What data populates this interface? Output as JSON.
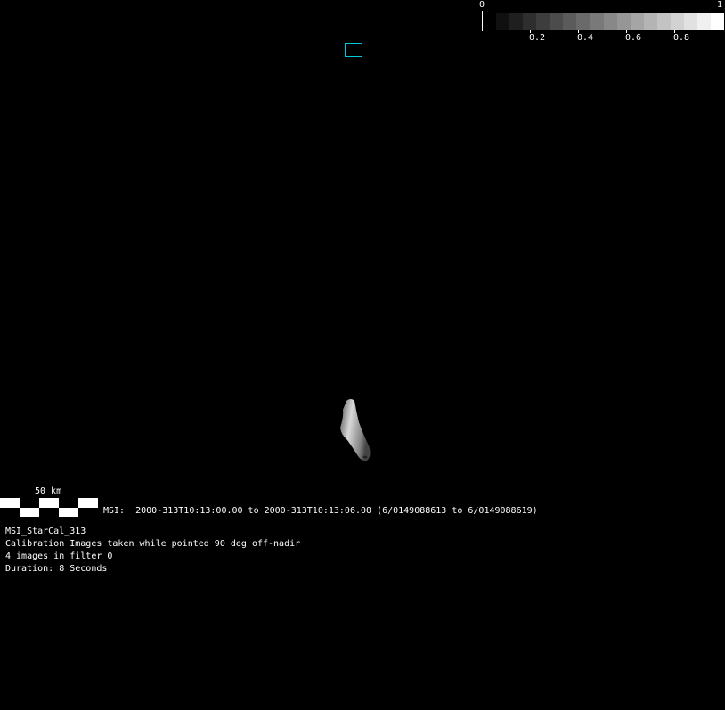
{
  "colorbar": {
    "min_label": "0",
    "max_label": "1",
    "tick_labels": [
      "0.2",
      "0.4",
      "0.6",
      "0.8"
    ],
    "steps": 17
  },
  "scale_bar": {
    "label": "50 km"
  },
  "msi_line": "MSI:  2000-313T10:13:00.00 to 2000-313T10:13:06.00 (6/0149088613 to 6/0149088619)",
  "info": {
    "title": "MSI_StarCal_313",
    "description": "Calibration Images taken while pointed 90 deg off-nadir",
    "count": "4 images in filter 0",
    "duration": "Duration: 8 Seconds"
  },
  "colors": {
    "marker": "#00c8d8"
  }
}
